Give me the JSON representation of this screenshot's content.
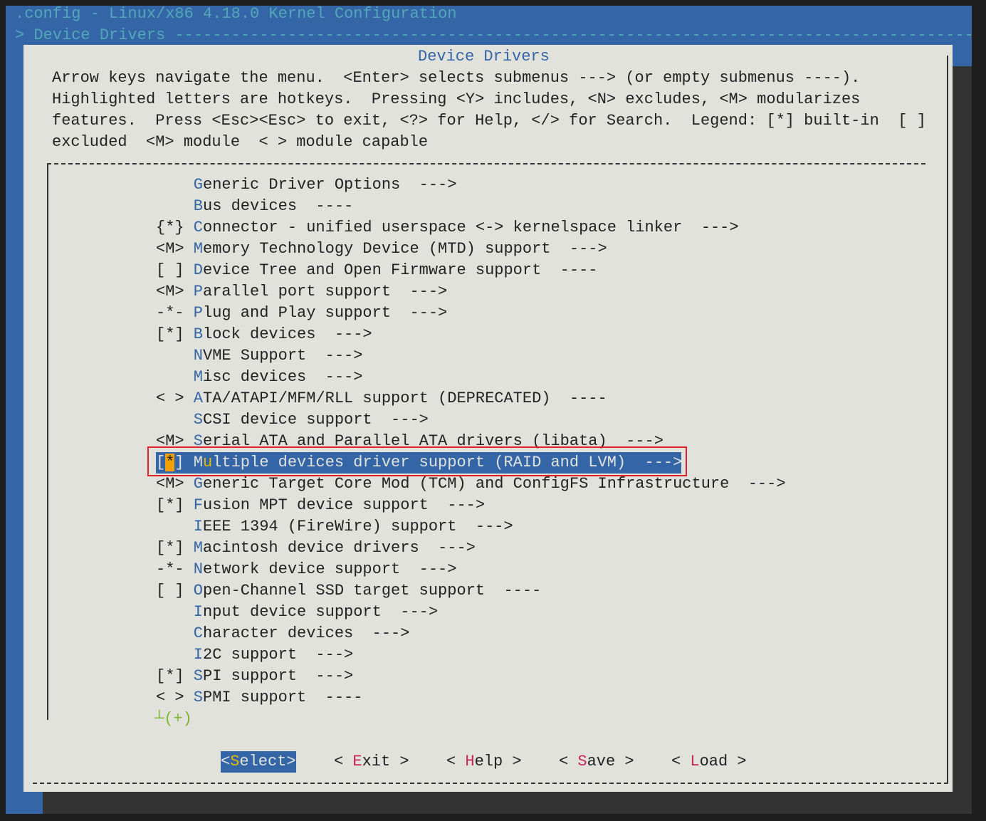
{
  "header": {
    "title": ".config - Linux/x86 4.18.0 Kernel Configuration",
    "breadcrumb": "> Device Drivers"
  },
  "dialog": {
    "title": "Device Drivers",
    "help": [
      "Arrow keys navigate the menu.  <Enter> selects submenus ---> (or empty submenus ----).",
      "Highlighted letters are hotkeys.  Pressing <Y> includes, <N> excludes, <M> modularizes",
      "features.  Press <Esc><Esc> to exit, <?> for Help, </> for Search.  Legend: [*] built-in  [ ]",
      "excluded  <M> module  < > module capable"
    ]
  },
  "menu": {
    "selected_index": 13,
    "items": [
      {
        "prefix": "",
        "label": "Generic Driver Options  --->"
      },
      {
        "prefix": "",
        "label": "Bus devices  ----"
      },
      {
        "prefix": "{*}",
        "label": "Connector - unified userspace <-> kernelspace linker  --->"
      },
      {
        "prefix": "<M>",
        "label": "Memory Technology Device (MTD) support  --->"
      },
      {
        "prefix": "[ ]",
        "label": "Device Tree and Open Firmware support  ----"
      },
      {
        "prefix": "<M>",
        "label": "Parallel port support  --->"
      },
      {
        "prefix": "-*-",
        "label": "Plug and Play support  --->"
      },
      {
        "prefix": "[*]",
        "label": "Block devices  --->"
      },
      {
        "prefix": "",
        "label": "NVME Support  --->"
      },
      {
        "prefix": "",
        "label": "Misc devices  --->"
      },
      {
        "prefix": "< >",
        "label": "ATA/ATAPI/MFM/RLL support (DEPRECATED)  ----"
      },
      {
        "prefix": "",
        "label": "SCSI device support  --->"
      },
      {
        "prefix": "<M>",
        "label": "Serial ATA and Parallel ATA drivers (libata)  --->"
      },
      {
        "prefix": "[*]",
        "label": "Multiple devices driver support (RAID and LVM)  --->"
      },
      {
        "prefix": "<M>",
        "label": "Generic Target Core Mod (TCM) and ConfigFS Infrastructure  --->"
      },
      {
        "prefix": "[*]",
        "label": "Fusion MPT device support  --->"
      },
      {
        "prefix": "",
        "label": "IEEE 1394 (FireWire) support  --->"
      },
      {
        "prefix": "[*]",
        "label": "Macintosh device drivers  --->"
      },
      {
        "prefix": "-*-",
        "label": "Network device support  --->"
      },
      {
        "prefix": "[ ]",
        "label": "Open-Channel SSD target support  ----"
      },
      {
        "prefix": "",
        "label": "Input device support  --->"
      },
      {
        "prefix": "",
        "label": "Character devices  --->"
      },
      {
        "prefix": "",
        "label": "I2C support  --->"
      },
      {
        "prefix": "[*]",
        "label": "SPI support  --->"
      },
      {
        "prefix": "< >",
        "label": "SPMI support  ----"
      }
    ],
    "more_indicator": "┴(+)"
  },
  "buttons": [
    {
      "key": "S",
      "rest": "elect",
      "open": "<",
      "close": ">"
    },
    {
      "key": "E",
      "rest": "xit",
      "open": "< ",
      "close": " >"
    },
    {
      "key": "H",
      "rest": "elp",
      "open": "< ",
      "close": " >"
    },
    {
      "key": "S",
      "rest": "ave",
      "open": "< ",
      "close": " >"
    },
    {
      "key": "L",
      "rest": "oad",
      "open": "< ",
      "close": " >"
    }
  ],
  "colors": {
    "background": "#3465a6",
    "dialog": "#e1e2dc",
    "hotkey": "#3465a4",
    "selected_hotkey": "#e5b800",
    "button_hotkey": "#c8245a",
    "highlight_frame": "#e0202a"
  }
}
